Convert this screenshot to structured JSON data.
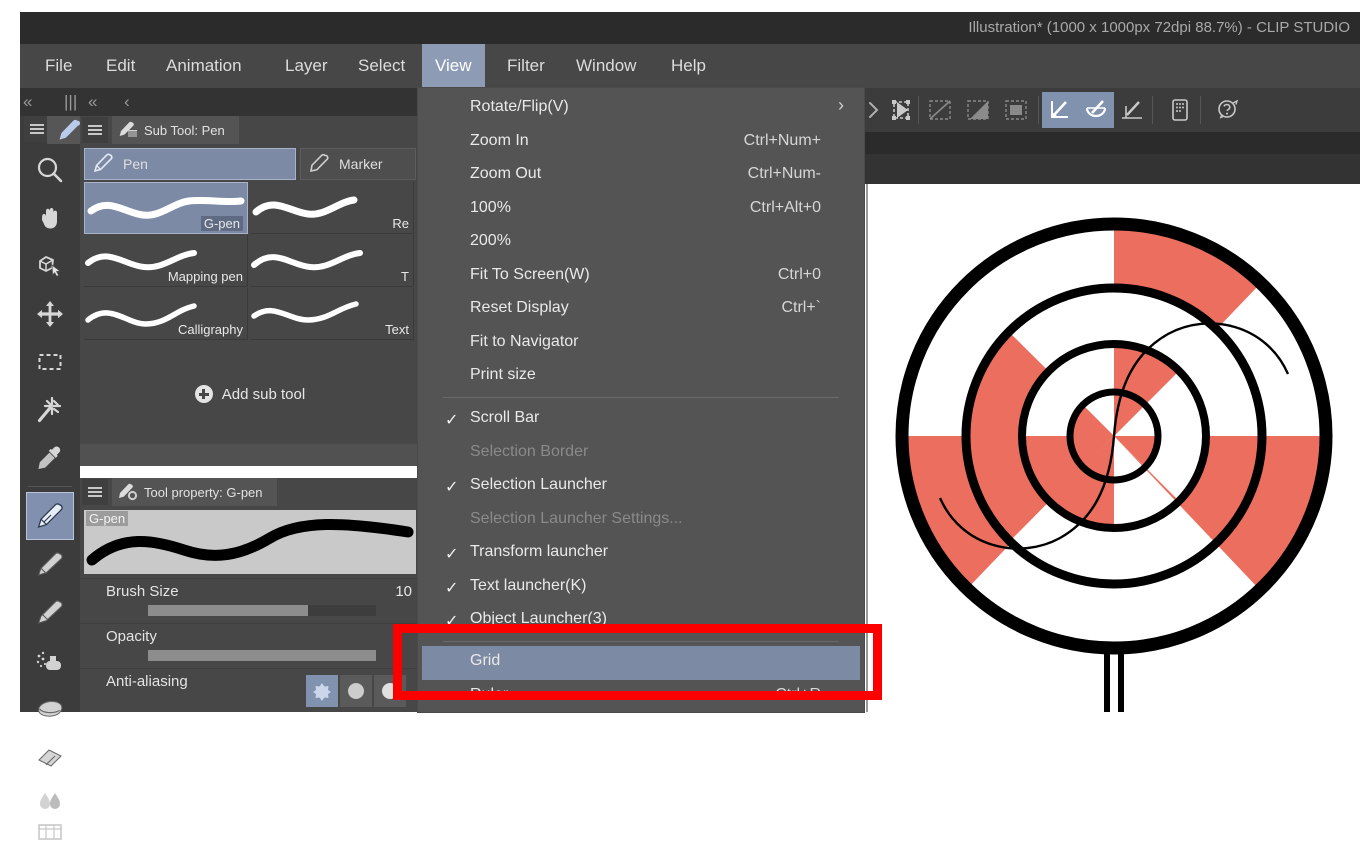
{
  "window": {
    "title": "Illustration* (1000 x 1000px 72dpi 88.7%)  - CLIP STUDIO"
  },
  "menubar": {
    "items": [
      {
        "label": "File",
        "active": false
      },
      {
        "label": "Edit",
        "active": false
      },
      {
        "label": "Animation",
        "active": false
      },
      {
        "label": "Layer",
        "active": false
      },
      {
        "label": "Select",
        "active": false
      },
      {
        "label": "View",
        "active": true
      },
      {
        "label": "Filter",
        "active": false
      },
      {
        "label": "Window",
        "active": false
      },
      {
        "label": "Help",
        "active": false
      }
    ]
  },
  "subbar": {
    "chevrons": [
      "«",
      "|||",
      "«",
      "‹"
    ]
  },
  "view_menu": {
    "items": [
      {
        "label": "Rotate/Flip(V)",
        "shortcut": "",
        "check": false,
        "disabled": false,
        "submenu": true,
        "highlighted": false
      },
      {
        "label": "Zoom In",
        "shortcut": "Ctrl+Num+",
        "check": false,
        "disabled": false,
        "submenu": false,
        "highlighted": false
      },
      {
        "label": "Zoom Out",
        "shortcut": "Ctrl+Num-",
        "check": false,
        "disabled": false,
        "submenu": false,
        "highlighted": false
      },
      {
        "label": "100%",
        "shortcut": "Ctrl+Alt+0",
        "check": false,
        "disabled": false,
        "submenu": false,
        "highlighted": false
      },
      {
        "label": "200%",
        "shortcut": "",
        "check": false,
        "disabled": false,
        "submenu": false,
        "highlighted": false
      },
      {
        "label": "Fit To Screen(W)",
        "shortcut": "Ctrl+0",
        "check": false,
        "disabled": false,
        "submenu": false,
        "highlighted": false
      },
      {
        "label": "Reset Display",
        "shortcut": "Ctrl+`",
        "check": false,
        "disabled": false,
        "submenu": false,
        "highlighted": false
      },
      {
        "label": "Fit to Navigator",
        "shortcut": "",
        "check": false,
        "disabled": false,
        "submenu": false,
        "highlighted": false
      },
      {
        "label": "Print size",
        "shortcut": "",
        "check": false,
        "disabled": false,
        "submenu": false,
        "highlighted": false
      },
      {
        "label": "Scroll Bar",
        "shortcut": "",
        "check": true,
        "disabled": false,
        "submenu": false,
        "highlighted": false
      },
      {
        "label": "Selection Border",
        "shortcut": "",
        "check": false,
        "disabled": true,
        "submenu": false,
        "highlighted": false
      },
      {
        "label": "Selection Launcher",
        "shortcut": "",
        "check": true,
        "disabled": false,
        "submenu": false,
        "highlighted": false
      },
      {
        "label": "Selection Launcher Settings...",
        "shortcut": "",
        "check": false,
        "disabled": true,
        "submenu": false,
        "highlighted": false
      },
      {
        "label": "Transform launcher",
        "shortcut": "",
        "check": true,
        "disabled": false,
        "submenu": false,
        "highlighted": false
      },
      {
        "label": "Text launcher(K)",
        "shortcut": "",
        "check": true,
        "disabled": false,
        "submenu": false,
        "highlighted": false
      },
      {
        "label": "Object Launcher(3)",
        "shortcut": "",
        "check": true,
        "disabled": false,
        "submenu": false,
        "highlighted": false
      },
      {
        "label": "Grid",
        "shortcut": "",
        "check": false,
        "disabled": false,
        "submenu": false,
        "highlighted": true
      },
      {
        "label": "Ruler",
        "shortcut": "Ctrl+R",
        "check": false,
        "disabled": false,
        "submenu": false,
        "highlighted": false
      }
    ],
    "separators_after": [
      8,
      15
    ]
  },
  "tools": {
    "items": [
      {
        "name": "magnifier-tool",
        "icon": "magnifier"
      },
      {
        "name": "hand-tool",
        "icon": "hand"
      },
      {
        "name": "rotate-tool",
        "icon": "cube-cursor"
      },
      {
        "name": "move-tool",
        "icon": "move-arrows"
      },
      {
        "name": "marquee-tool",
        "icon": "dashed-rect"
      },
      {
        "name": "auto-select-tool",
        "icon": "wand"
      },
      {
        "name": "eyedropper-tool",
        "icon": "eyedropper"
      },
      {
        "name": "pen-tool",
        "icon": "pen-nib",
        "selected": true
      },
      {
        "name": "pencil-tool",
        "icon": "pencil"
      },
      {
        "name": "brush-tool",
        "icon": "brush"
      },
      {
        "name": "airbrush-tool",
        "icon": "airbrush"
      },
      {
        "name": "decoration-tool",
        "icon": "decoration"
      },
      {
        "name": "eraser-tool",
        "icon": "eraser"
      },
      {
        "name": "blend-tool",
        "icon": "blend-drops"
      },
      {
        "name": "figure-tool",
        "icon": "figure-box"
      }
    ]
  },
  "sub_tool_panel": {
    "tab_title": "Sub Tool: Pen",
    "groups": [
      {
        "label": "Pen",
        "active": true
      },
      {
        "label": "Marker",
        "active": false
      }
    ],
    "brushes": [
      {
        "label": "G-pen",
        "selected": true
      },
      {
        "label": "Re",
        "selected": false
      },
      {
        "label": "Mapping pen",
        "selected": false
      },
      {
        "label": "T",
        "selected": false
      },
      {
        "label": "Calligraphy",
        "selected": false
      },
      {
        "label": "Text",
        "selected": false
      }
    ],
    "add_sub_tool_label": "Add sub tool"
  },
  "tool_property_panel": {
    "tab_title": "Tool property: G-pen",
    "preview_tag": "G-pen",
    "rows": [
      {
        "name": "Brush Size",
        "value": "10",
        "slider": 70
      },
      {
        "name": "Opacity",
        "value": "",
        "slider": 100
      },
      {
        "name": "Anti-aliasing",
        "value": "",
        "slider": null
      }
    ]
  },
  "option_toolbar": {
    "buttons": [
      {
        "name": "chevron-right-icon",
        "on": false
      },
      {
        "name": "play-arrow-icon",
        "on": false
      },
      {
        "name": "transform-box-icon",
        "on": false
      },
      {
        "name": "no-selection-icon",
        "on": false
      },
      {
        "name": "half-selection-icon",
        "on": false
      },
      {
        "name": "full-selection-icon",
        "on": false
      },
      {
        "name": "snap-corner-icon",
        "on": true
      },
      {
        "name": "snap-curve-icon",
        "on": true
      },
      {
        "name": "snap-line-icon",
        "on": false
      },
      {
        "name": "tablet-icon",
        "on": false
      },
      {
        "name": "help-icon",
        "on": false
      }
    ]
  },
  "canvas": {
    "artwork_name": "spiral-lollipop-drawing",
    "colors": {
      "fill": "#ec6e5e",
      "outline": "#000000",
      "background": "#ffffff"
    }
  },
  "annotation": {
    "name": "red-highlight-box",
    "color": "#fc0000",
    "targets": "Grid"
  }
}
